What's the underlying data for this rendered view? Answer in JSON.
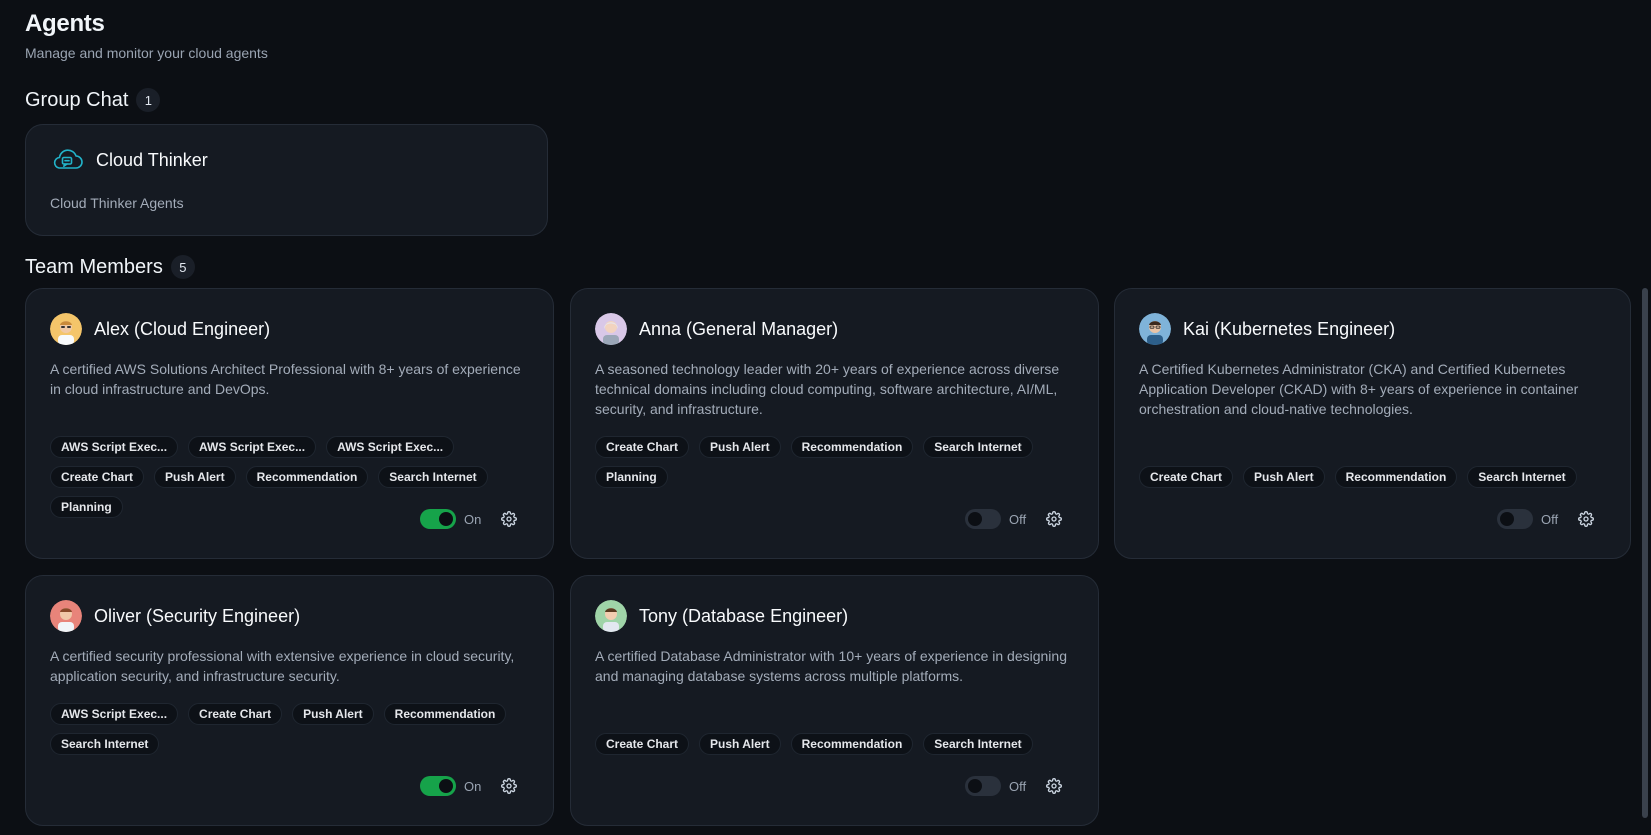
{
  "page": {
    "title": "Agents",
    "subtitle": "Manage and monitor your cloud agents"
  },
  "group_chat": {
    "title": "Group Chat",
    "count": "1",
    "card": {
      "name": "Cloud Thinker",
      "description": "Cloud Thinker Agents",
      "icon": "cloud-chat-icon"
    }
  },
  "team": {
    "title": "Team Members",
    "count": "5",
    "members": [
      {
        "name": "Alex (Cloud Engineer)",
        "description": "A certified AWS Solutions Architect Professional with 8+ years of experience in cloud infrastructure and DevOps.",
        "tags": [
          "AWS Script Exec...",
          "AWS Script Exec...",
          "AWS Script Exec...",
          "Create Chart",
          "Push Alert",
          "Recommendation",
          "Search Internet",
          "Planning"
        ],
        "status": "On",
        "avatar_color": "#f4c56a"
      },
      {
        "name": "Anna (General Manager)",
        "description": "A seasoned technology leader with 20+ years of experience across diverse technical domains including cloud computing, software architecture, AI/ML, security, and infrastructure.",
        "tags": [
          "Create Chart",
          "Push Alert",
          "Recommendation",
          "Search Internet",
          "Planning"
        ],
        "status": "Off",
        "avatar_color": "#d9c8e8"
      },
      {
        "name": "Kai (Kubernetes Engineer)",
        "description": "A Certified Kubernetes Administrator (CKA) and Certified Kubernetes Application Developer (CKAD) with 8+ years of experience in container orchestration and cloud-native technologies.",
        "tags": [
          "Create Chart",
          "Push Alert",
          "Recommendation",
          "Search Internet"
        ],
        "status": "Off",
        "avatar_color": "#7fb3d9"
      },
      {
        "name": "Oliver (Security Engineer)",
        "description": "A certified security professional with extensive experience in cloud security, application security, and infrastructure security.",
        "tags": [
          "AWS Script Exec...",
          "Create Chart",
          "Push Alert",
          "Recommendation",
          "Search Internet"
        ],
        "status": "On",
        "avatar_color": "#e8847a"
      },
      {
        "name": "Tony (Database Engineer)",
        "description": "A certified Database Administrator with 10+ years of experience in designing and managing database systems across multiple platforms.",
        "tags": [
          "Create Chart",
          "Push Alert",
          "Recommendation",
          "Search Internet"
        ],
        "status": "Off",
        "avatar_color": "#9fd4a8"
      }
    ]
  },
  "colors": {
    "background": "#0c0f14",
    "card": "#151a22",
    "toggle_on": "#16a34a",
    "accent_cyan": "#22b3c9"
  }
}
